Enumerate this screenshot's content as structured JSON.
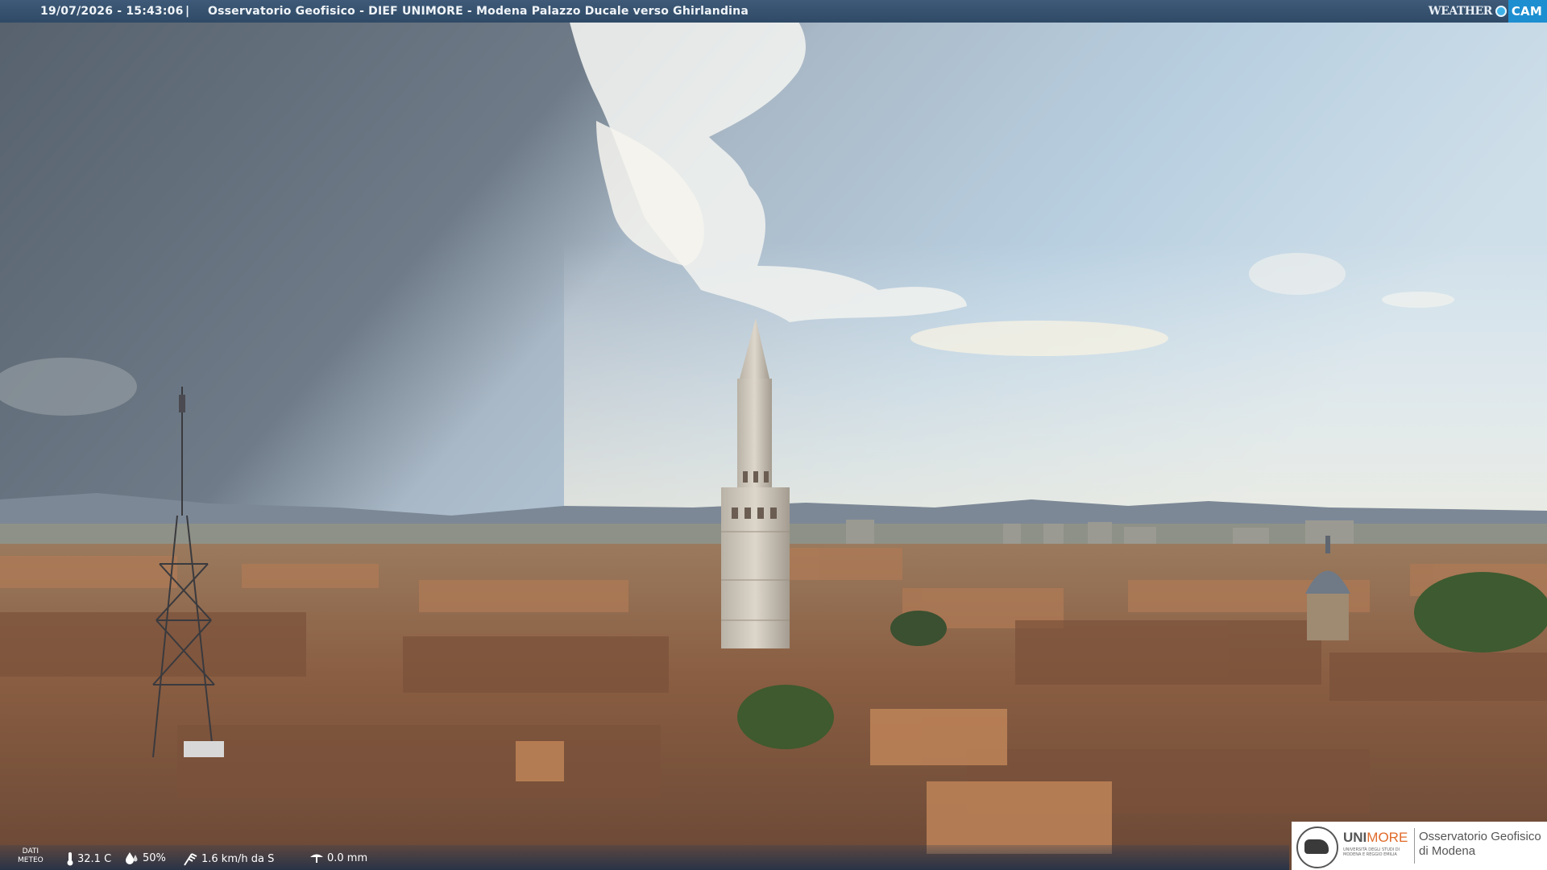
{
  "header": {
    "timestamp": "19/07/2026 - 15:43:06",
    "separator": "|",
    "title": "Osservatorio Geofisico - DIEF UNIMORE - Modena Palazzo Ducale verso Ghirlandina",
    "brand_left": "WEATHER",
    "brand_right": "CAM"
  },
  "weather": {
    "label_line1": "DATI",
    "label_line2": "METEO",
    "temperature": "32.1 C",
    "humidity": "50%",
    "wind": "1.6 km/h da S",
    "rain": "0.0 mm",
    "icons": [
      "thermometer-icon",
      "humidity-drop-icon",
      "wind-icon",
      "rain-gauge-icon"
    ]
  },
  "logo": {
    "university_prefix": "UNI",
    "university_suffix": "MORE",
    "university_sub1": "UNIVERSITÀ DEGLI STUDI DI",
    "university_sub2": "MODENA E REGGIO EMILIA",
    "observatory_line1": "Osservatorio Geofisico",
    "observatory_line2": "di Modena"
  },
  "colors": {
    "topbar": "#2f4a66",
    "accent": "#1d8fd1",
    "unimore_orange": "#e06a2a"
  }
}
